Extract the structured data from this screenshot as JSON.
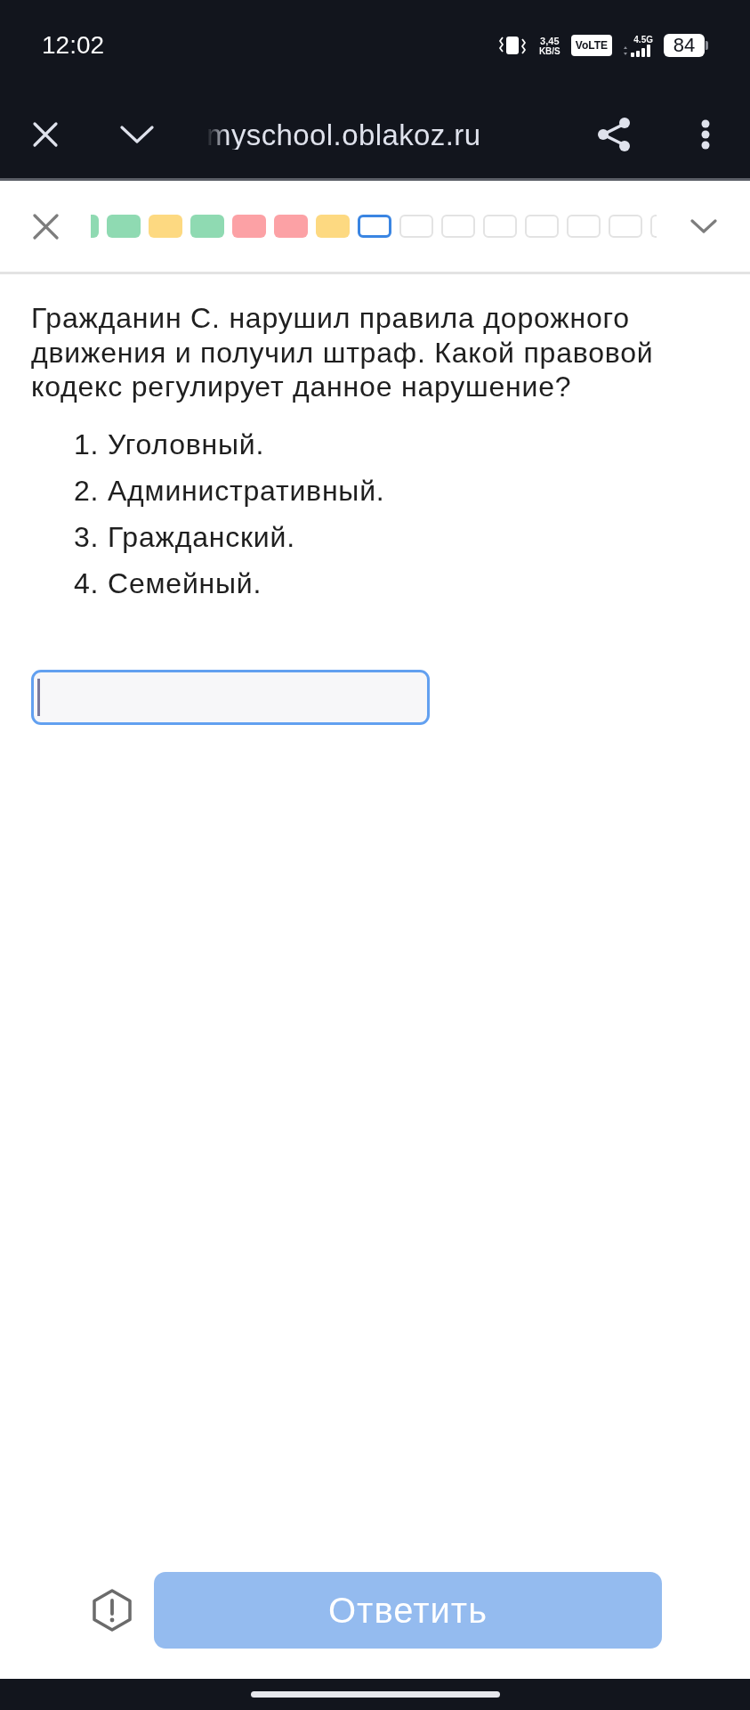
{
  "status_bar": {
    "time": "12:02",
    "network_speed": "3,45",
    "speed_unit": "KB/S",
    "volte": "VoLTE",
    "network_type": "4.5G",
    "battery": "84"
  },
  "browser_bar": {
    "url": "myschool.oblakoz.ru"
  },
  "question_tiles": [
    {
      "color": "#8fdab2",
      "selected": false
    },
    {
      "color": "#8fdab2",
      "selected": false
    },
    {
      "color": "#fdd981",
      "selected": false
    },
    {
      "color": "#8fdab2",
      "selected": false
    },
    {
      "color": "#fca1a5",
      "selected": false
    },
    {
      "color": "#fca1a5",
      "selected": false
    },
    {
      "color": "#fdd981",
      "selected": false
    },
    {
      "color": "#ffffff",
      "selected": true
    },
    {
      "color": "#ffffff",
      "selected": false
    },
    {
      "color": "#ffffff",
      "selected": false
    },
    {
      "color": "#ffffff",
      "selected": false
    },
    {
      "color": "#ffffff",
      "selected": false
    },
    {
      "color": "#ffffff",
      "selected": false
    },
    {
      "color": "#ffffff",
      "selected": false
    },
    {
      "color": "#ffffff",
      "selected": false
    }
  ],
  "question": {
    "text": "Гражданин С. нарушил правила дорожного движения и получил штраф. Какой правовой кодекс регулирует данное нарушение?",
    "options": [
      "1. Уголовный.",
      "2. Административный.",
      "3. Гражданский.",
      "4. Семейный."
    ]
  },
  "answer_field": {
    "focused": true
  },
  "submit_button": {
    "label": "Ответить",
    "disabled": true
  }
}
